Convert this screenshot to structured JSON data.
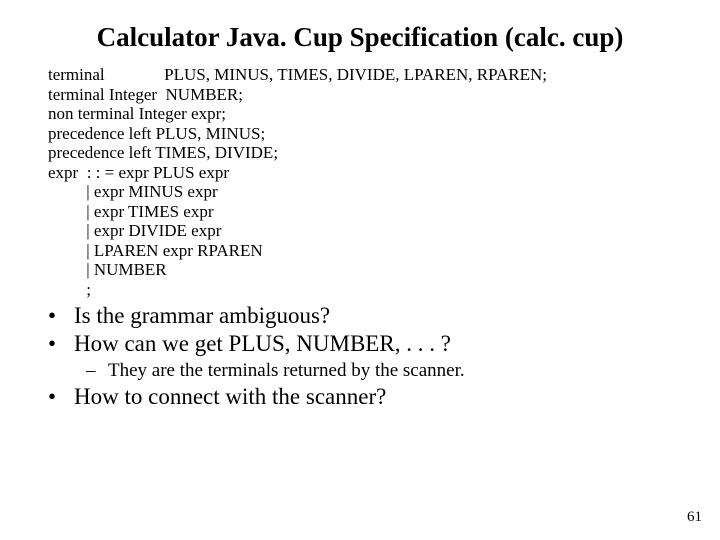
{
  "title": "Calculator Java. Cup Specification (calc. cup)",
  "spec": {
    "l1a": "terminal",
    "l1b": "PLUS, MINUS, TIMES, DIVIDE, LPAREN, RPAREN;",
    "l2": "terminal Integer  NUMBER;",
    "l3": "non terminal Integer expr;",
    "l4": "precedence left PLUS, MINUS;",
    "l5": "precedence left TIMES, DIVIDE;",
    "l6": "expr  : : = expr PLUS expr",
    "l7": "         | expr MINUS expr",
    "l8": "         | expr TIMES expr",
    "l9": "         | expr DIVIDE expr",
    "l10": "         | LPAREN expr RPAREN",
    "l11": "         | NUMBER",
    "l12": "         ;"
  },
  "bullets": {
    "q1": "Is the grammar ambiguous?",
    "q2": "How can we get PLUS, NUMBER, . . . ?",
    "sub1": "They are the terminals returned by the scanner.",
    "q3": "How to connect with the scanner?"
  },
  "marks": {
    "dot": "•",
    "dash": "–"
  },
  "page": "61"
}
